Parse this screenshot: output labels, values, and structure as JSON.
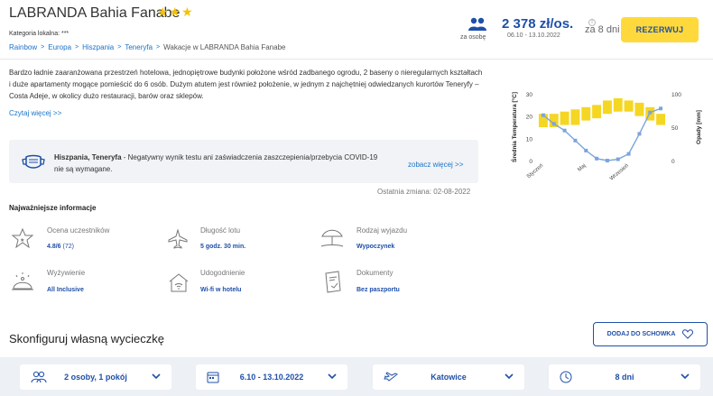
{
  "header": {
    "hotel_name": "LABRANDA Bahia Fanabe",
    "stars": "★★★",
    "category": "Kategoria lokalna: ***",
    "people_label": "za osobę",
    "price": "2 378 zł/os.",
    "price_info": "i",
    "price_dates": "06.10 - 13.10.2022",
    "days": "za 8 dni",
    "reserve_label": "REZERWUJ"
  },
  "breadcrumb": [
    "Rainbow",
    "Europa",
    "Hiszpania",
    "Teneryfa",
    "Wakacje w LABRANDA Bahia Fanabe"
  ],
  "breadcrumb_sep": ">",
  "description": {
    "text": "Bardzo ładnie zaaranżowana przestrzeń hotelowa, jednopiętrowe budynki położone wśród zadbanego ogrodu, 2 baseny o nieregularnych kształtach i duże apartamenty mogące pomieścić do 6 osób. Dużym atutem jest również położenie, w jednym z najchętniej odwiedzanych kurortów Teneryfy – Costa Adeje, w okolicy dużo restauracji, barów oraz sklepów.",
    "read_more": "Czytaj więcej >>"
  },
  "covid": {
    "location": "Hiszpania, Teneryfa",
    "message": " - Negatywny wynik testu ani zaświadczenia zaszczepienia/przebycia COVID-19 nie są wymagane.",
    "link": "zobacz więcej >>"
  },
  "last_change": "Ostatnia zmiana: 02-08-2022",
  "important": {
    "title": "Najważniejsze informacje",
    "items": [
      {
        "label": "Ocena uczestników",
        "value": "4.8/6",
        "extra": "(72)",
        "icon": "rating-star-icon"
      },
      {
        "label": "Długość lotu",
        "value": "5 godz. 30 min.",
        "icon": "plane-icon"
      },
      {
        "label": "Rodzaj wyjazdu",
        "value": "Wypoczynek",
        "icon": "beach-umbrella-icon"
      },
      {
        "label": "Wyżywienie",
        "value": "All Inclusive",
        "icon": "food-cloche-icon"
      },
      {
        "label": "Udogodnienie",
        "value": "Wi-fi w hotelu",
        "icon": "wifi-house-icon"
      },
      {
        "label": "Dokumenty",
        "value": "Bez paszportu",
        "icon": "passport-icon"
      }
    ]
  },
  "configure": {
    "title": "Skonfiguruj własną wycieczkę",
    "favorites_label": "DODAJ DO SCHOWKA",
    "selects": [
      {
        "value": "2 osoby, 1 pokój",
        "icon": "people-icon"
      },
      {
        "value": "6.10 - 13.10.2022",
        "icon": "calendar-icon"
      },
      {
        "value": "Katowice",
        "icon": "departure-plane-icon"
      },
      {
        "value": "8 dni",
        "icon": "clock-icon"
      }
    ]
  },
  "chart_data": {
    "type": "bar",
    "ylabel": "Średnia Temperatura [°C]",
    "y2label": "Opady [mm]",
    "ylim": [
      0,
      30
    ],
    "y2lim": [
      0,
      100
    ],
    "y_ticks": [
      "0",
      "10",
      "20",
      "30"
    ],
    "y2_ticks": [
      "0",
      "50",
      "100"
    ],
    "x_tick_labels": [
      "Styczeń",
      "Maj",
      "Wrzesień"
    ],
    "x_tick_months": [
      1,
      5,
      9
    ],
    "months": [
      1,
      2,
      3,
      4,
      5,
      6,
      7,
      8,
      9,
      10,
      11,
      12
    ],
    "series": [
      {
        "type": "range-bar",
        "low": [
          15,
          15,
          16,
          16,
          18,
          19,
          21,
          22,
          22,
          20,
          18,
          16
        ],
        "high": [
          21,
          21,
          22,
          23,
          24,
          25,
          27,
          28,
          27,
          26,
          24,
          21
        ],
        "color": "#f5d623"
      },
      {
        "type": "line",
        "values": [
          68,
          55,
          45,
          30,
          15,
          3,
          0,
          2,
          10,
          40,
          72,
          78
        ],
        "color": "#7ba4dc"
      }
    ],
    "grid": false
  }
}
